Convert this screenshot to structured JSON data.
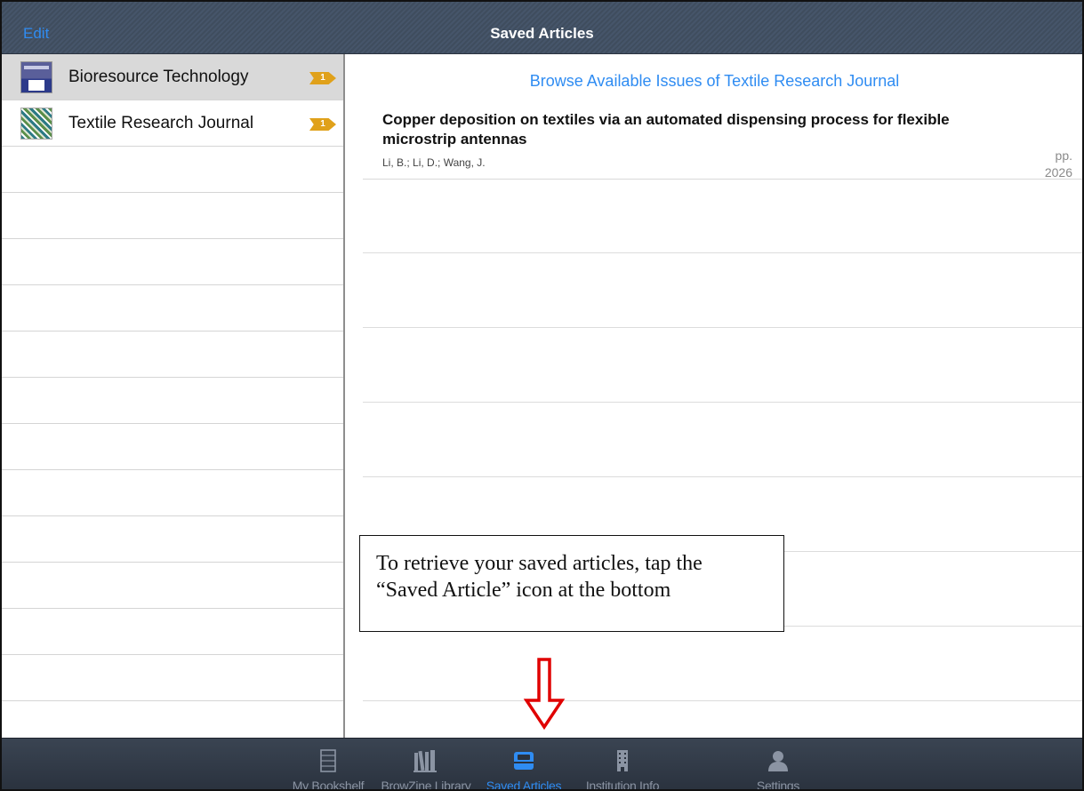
{
  "navbar": {
    "edit_label": "Edit",
    "title": "Saved Articles"
  },
  "sidebar": {
    "journals": [
      {
        "title": "Bioresource Technology",
        "badge": "1",
        "selected": true
      },
      {
        "title": "Textile Research Journal",
        "badge": "1",
        "selected": false
      }
    ]
  },
  "main": {
    "browse_link": "Browse Available Issues of Textile Research Journal",
    "article": {
      "title": "Copper deposition on textiles via an automated dispensing process for flexible microstrip antennas",
      "authors": "Li, B.; Li, D.; Wang, J.",
      "pages_label": "pp.",
      "pages_value": "2026"
    }
  },
  "callout": {
    "text": "To retrieve your saved articles, tap the “Saved Article” icon at the bottom"
  },
  "tabbar": {
    "tabs": [
      {
        "label": "My Bookshelf",
        "icon": "bookshelf-icon",
        "active": false
      },
      {
        "label": "BrowZine Library",
        "icon": "library-icon",
        "active": false
      },
      {
        "label": "Saved Articles",
        "icon": "saved-articles-icon",
        "active": true
      },
      {
        "label": "Institution Info",
        "icon": "institution-icon",
        "active": false
      },
      {
        "label": "Settings",
        "icon": "settings-icon",
        "active": false
      }
    ]
  },
  "colors": {
    "accent": "#2f8cf2",
    "badge": "#e0a11a",
    "annotation_arrow": "#e00000"
  }
}
